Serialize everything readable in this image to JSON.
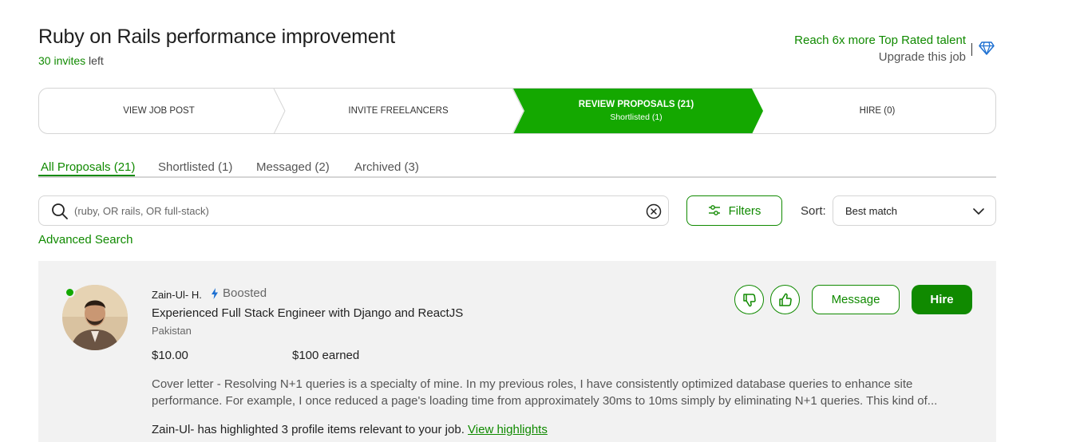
{
  "header": {
    "job_title": "Ruby on Rails performance improvement",
    "invites_count": "30 invites",
    "invites_suffix": "left",
    "upsell_line": "Reach 6x more Top Rated talent",
    "upgrade_link": "Upgrade this job"
  },
  "stepper": {
    "steps": [
      {
        "label": "VIEW JOB POST"
      },
      {
        "label": "INVITE FREELANCERS"
      },
      {
        "label": "REVIEW PROPOSALS (21)",
        "sub": "Shortlisted (1)",
        "active": true
      },
      {
        "label": "HIRE (0)"
      }
    ]
  },
  "tabs": [
    {
      "label": "All Proposals (21)",
      "active": true
    },
    {
      "label": "Shortlisted (1)"
    },
    {
      "label": "Messaged (2)"
    },
    {
      "label": "Archived (3)"
    }
  ],
  "search": {
    "placeholder": "(ruby, OR rails, OR full-stack)",
    "value": ""
  },
  "filters_label": "Filters",
  "sort": {
    "label": "Sort:",
    "selected": "Best match"
  },
  "advanced_search": "Advanced Search",
  "proposal": {
    "name": "Zain-Ul- H.",
    "badge": "Boosted",
    "headline": "Experienced Full Stack Engineer with Django and ReactJS",
    "country": "Pakistan",
    "rate": "$10.00",
    "earned": "$100 earned",
    "cover_letter": "Cover letter - Resolving N+1 queries is a specialty of mine. In my previous roles, I have consistently optimized database queries to enhance site performance. For example, I once reduced a page's loading time from approximately 30ms to 10ms simply by eliminating N+1 queries. This kind of...",
    "highlights_text": "Zain-Ul- has highlighted 3 profile items relevant to your job.",
    "highlights_link": "View highlights",
    "message_label": "Message",
    "hire_label": "Hire",
    "online": true
  },
  "colors": {
    "brand": "#108a00",
    "active_step": "#14a800",
    "card_bg": "#f2f2f2"
  },
  "icons": [
    "diamond-icon",
    "search-icon",
    "clear-icon",
    "filters-icon",
    "chevron-down-icon",
    "bolt-icon",
    "thumbs-down-icon",
    "thumbs-up-icon"
  ]
}
